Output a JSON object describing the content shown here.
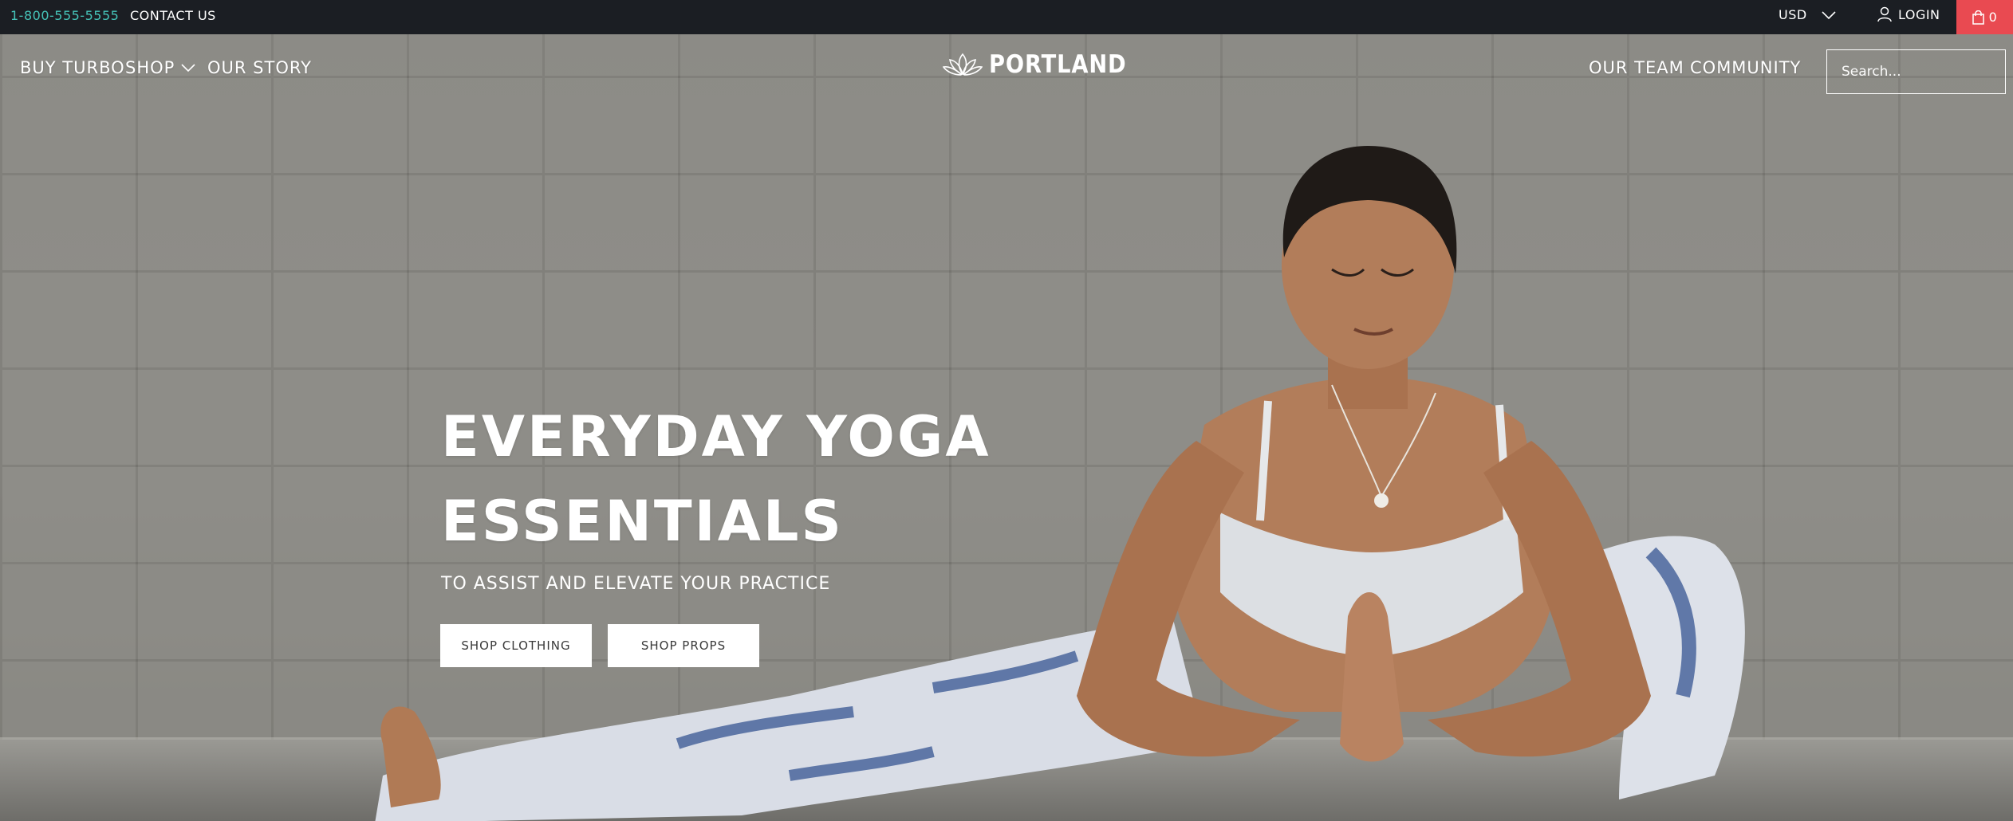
{
  "topbar": {
    "phone": "1-800-555-5555",
    "contact": "CONTACT US",
    "currency": "USD",
    "login": "LOGIN",
    "cart_count": "0"
  },
  "nav": {
    "left": [
      {
        "label": "BUY TURBO"
      },
      {
        "label": "SHOP"
      },
      {
        "label": "OUR STORY"
      }
    ],
    "logo": "PORTLAND",
    "right": [
      {
        "label": "OUR TEAM"
      },
      {
        "label": "COMMUNITY"
      }
    ],
    "search_placeholder": "Search..."
  },
  "hero": {
    "headline_line1": "EVERYDAY YOGA",
    "headline_line2": "ESSENTIALS",
    "subheading": "TO ASSIST AND ELEVATE YOUR PRACTICE",
    "buttons": [
      {
        "label": "SHOP CLOTHING"
      },
      {
        "label": "SHOP PROPS"
      }
    ]
  },
  "colors": {
    "topbar_bg": "#1b1e23",
    "phone_accent": "#45c3b8",
    "cart_bg": "#e94a51"
  },
  "icons": [
    "chevron-down-icon",
    "user-icon",
    "bag-icon",
    "lotus-icon",
    "search-icon"
  ]
}
